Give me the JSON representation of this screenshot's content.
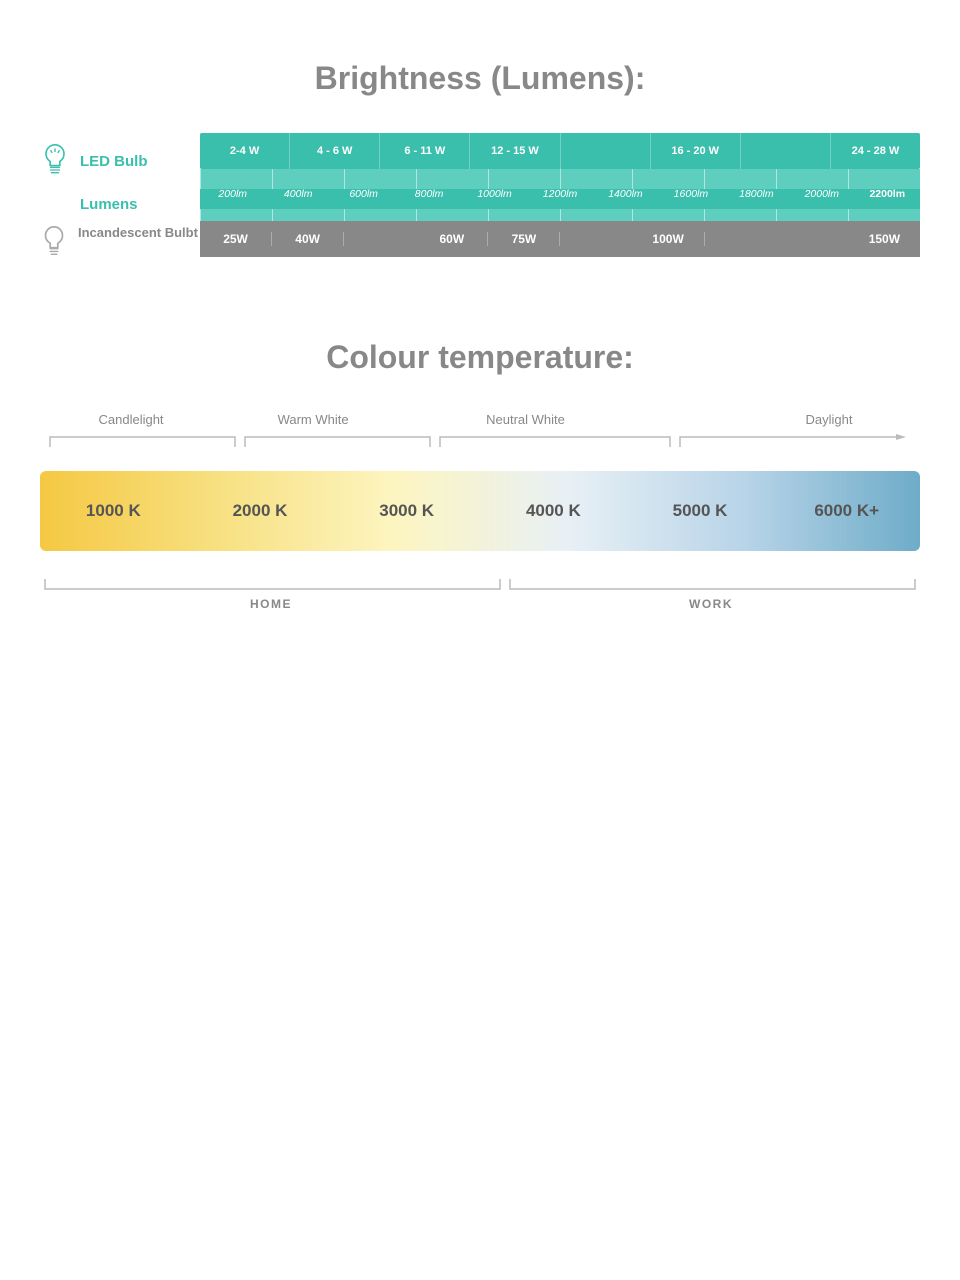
{
  "brightness": {
    "title": "Brightness (Lumens):",
    "led_label": "LED Bulb",
    "lumens_label": "Lumens",
    "incandescent_label": "Incandescent Bulbt",
    "watt_segments": [
      "2-4 W",
      "4 - 6 W",
      "6 - 11 W",
      "12 - 15 W",
      "",
      "16 - 20 W",
      "",
      "24 - 28 W"
    ],
    "lumen_values": [
      "200lm",
      "400lm",
      "600lm",
      "800lm",
      "1000lm",
      "1200lm",
      "1400lm",
      "1600lm",
      "1800lm",
      "2000lm",
      "2200lm"
    ],
    "inc_segments": [
      "25W",
      "40W",
      "",
      "60W",
      "75W",
      "",
      "100W",
      "",
      "",
      "150W"
    ]
  },
  "colour_temperature": {
    "title": "Colour temperature:",
    "categories": [
      "Candlelight",
      "Warm White",
      "Neutral White",
      "",
      "Daylight"
    ],
    "temperatures": [
      "1000 K",
      "2000 K",
      "3000 K",
      "4000 K",
      "5000 K",
      "6000 K+"
    ],
    "usage_labels": [
      "HOME",
      "WORK"
    ],
    "arrow_label": "→"
  },
  "colors": {
    "teal": "#3bbfad",
    "teal_light": "#5ecfbf",
    "gray": "#888888",
    "white": "#ffffff"
  }
}
